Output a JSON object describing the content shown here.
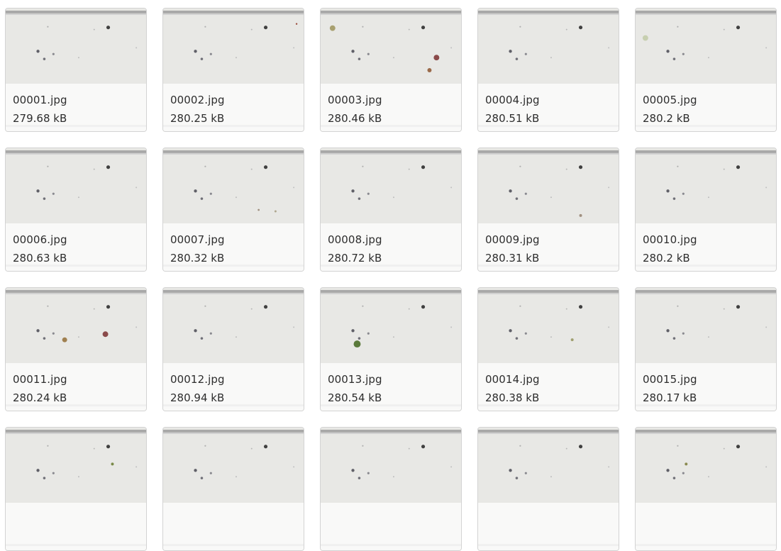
{
  "gallery": {
    "items": [
      {
        "name": "00001.jpg",
        "size": "279.68 kB"
      },
      {
        "name": "00002.jpg",
        "size": "280.25 kB"
      },
      {
        "name": "00003.jpg",
        "size": "280.46 kB"
      },
      {
        "name": "00004.jpg",
        "size": "280.51 kB"
      },
      {
        "name": "00005.jpg",
        "size": "280.2 kB"
      },
      {
        "name": "00006.jpg",
        "size": "280.63 kB"
      },
      {
        "name": "00007.jpg",
        "size": "280.32 kB"
      },
      {
        "name": "00008.jpg",
        "size": "280.72 kB"
      },
      {
        "name": "00009.jpg",
        "size": "280.31 kB"
      },
      {
        "name": "00010.jpg",
        "size": "280.2 kB"
      },
      {
        "name": "00011.jpg",
        "size": "280.24 kB"
      },
      {
        "name": "00012.jpg",
        "size": "280.94 kB"
      },
      {
        "name": "00013.jpg",
        "size": "280.54 kB"
      },
      {
        "name": "00014.jpg",
        "size": "280.38 kB"
      },
      {
        "name": "00015.jpg",
        "size": "280.17 kB"
      },
      {
        "name": "",
        "size": ""
      },
      {
        "name": "",
        "size": ""
      },
      {
        "name": "",
        "size": ""
      },
      {
        "name": "",
        "size": ""
      },
      {
        "name": "",
        "size": ""
      }
    ]
  }
}
